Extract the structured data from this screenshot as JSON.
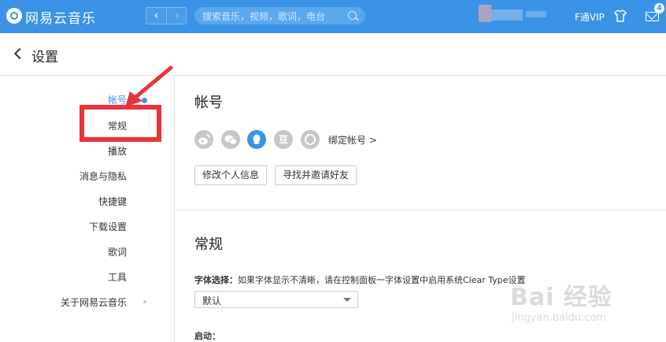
{
  "topbar": {
    "brand": "网易云音乐",
    "search_placeholder": "搜索音乐，视频，歌词，电台",
    "vip": "F通VIP",
    "mail_badge": "4",
    "colors": {
      "bar": "#3a93e6",
      "accent": "#3a93e6",
      "annotation": "#e8343a"
    }
  },
  "header": {
    "title": "设置"
  },
  "sidebar": {
    "items": [
      {
        "label": "帐号",
        "active": true
      },
      {
        "label": "常规"
      },
      {
        "label": "播放"
      },
      {
        "label": "消息与隐私"
      },
      {
        "label": "快捷键"
      },
      {
        "label": "下载设置"
      },
      {
        "label": "歌词"
      },
      {
        "label": "工具"
      },
      {
        "label": "关于网易云音乐"
      }
    ]
  },
  "account": {
    "title": "帐号",
    "share_icons": [
      "weibo-icon",
      "wechat-icon",
      "qq-icon",
      "douban-icon",
      "renren-icon"
    ],
    "douban_glyph": "豆",
    "bind_label": "绑定帐号 >",
    "edit_profile": "修改个人信息",
    "find_friends": "寻找并邀请好友"
  },
  "general": {
    "title": "常规",
    "font_label_bold": "字体选择：",
    "font_label_rest": "如果字体显示不清晰，请在控制面板一字体设置中启用系统Clear Type设置",
    "font_value": "默认",
    "startup_label": "启动："
  },
  "watermark": {
    "logo": "Bai 经验",
    "url": "jingyan.baidu.com"
  }
}
